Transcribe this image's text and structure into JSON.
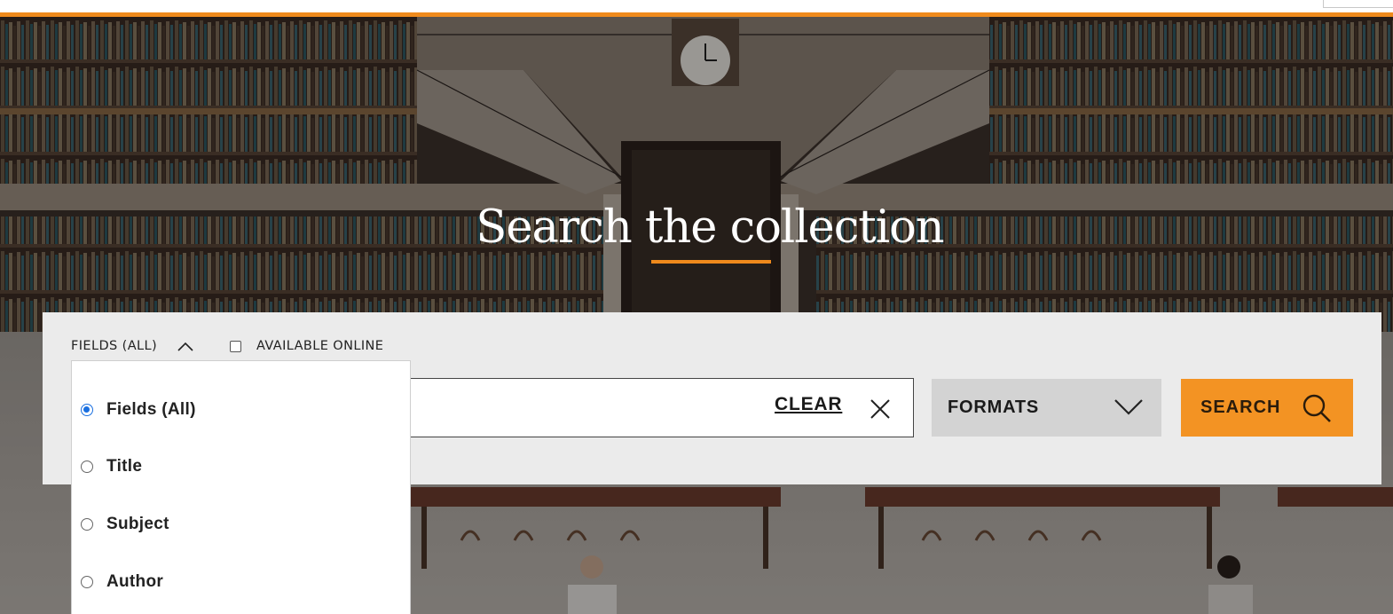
{
  "hero": {
    "title": "Search the collection"
  },
  "search": {
    "fields_toggle_label": "FIELDS (ALL)",
    "available_online_label": "AVAILABLE ONLINE",
    "available_online_checked": false,
    "input_value": "",
    "clear_label": "CLEAR",
    "formats_label": "FORMATS",
    "search_label": "SEARCH"
  },
  "fields_dropdown": {
    "expanded": true,
    "selected": "Fields (All)",
    "options": [
      {
        "label": "Fields (All)"
      },
      {
        "label": "Title"
      },
      {
        "label": "Subject"
      },
      {
        "label": "Author"
      }
    ]
  },
  "colors": {
    "accent_orange": "#ef8a1c",
    "search_button": "#f39323",
    "panel_background": "#ebebeb",
    "formats_button": "#d3d3d3",
    "radio_selected": "#1a6fe0"
  },
  "icons": {
    "fields_toggle": "chevron-up-icon",
    "clear": "close-icon",
    "formats": "chevron-down-icon",
    "search": "search-icon"
  }
}
